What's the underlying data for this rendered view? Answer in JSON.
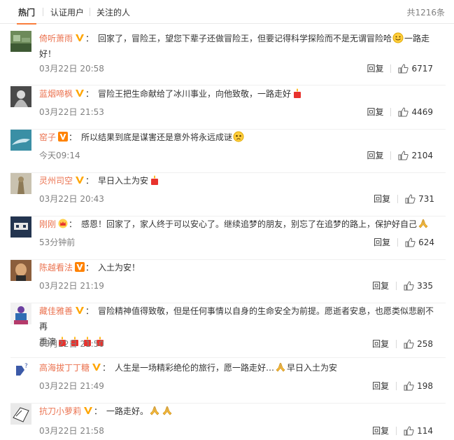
{
  "header": {
    "tabs": [
      {
        "label": "热门"
      },
      {
        "label": "认证用户"
      },
      {
        "label": "关注的人"
      }
    ],
    "total": "共1216条"
  },
  "labels": {
    "reply": "回复",
    "colon": "："
  },
  "colors": {
    "accent": "#fa7d3c",
    "username": "#eb7350",
    "vip": "#ffa500"
  },
  "comments": [
    {
      "user": "倚听萧雨",
      "badge": "v-yellow",
      "text1": "回家了，冒险王，望您下辈子还做冒险王，但要记得科学探险而不是无谓冒险哈",
      "emoji1": "smile-emoji",
      "text2": "一路走好！",
      "time": "03月22日 20:58",
      "likes": "6717"
    },
    {
      "user": "蓝烟啼枫",
      "badge": "v-yellow",
      "text1": "冒险王把生命献给了冰川事业，向他致敬，一路走好",
      "emoji1": "candle-emoji",
      "time": "03月22日 21:53",
      "likes": "4469"
    },
    {
      "user": "窑子",
      "badge": "v-orange",
      "text1": "所以结果到底是谋害还是意外将永远成谜",
      "emoji1": "sad-emoji",
      "time": "今天09:14",
      "likes": "2104"
    },
    {
      "user": "灵州司空",
      "badge": "v-yellow",
      "text1": "早日入土为安",
      "emoji1": "candle-emoji",
      "time": "03月22日 20:43",
      "likes": "731"
    },
    {
      "user": "刚刚",
      "badge": "crown",
      "text1": "感恩！回家了，家人终于可以安心了。继续追梦的朋友，别忘了在追梦的路上，保护好自己",
      "emoji1": "pray-emoji",
      "time": "53分钟前",
      "likes": "624"
    },
    {
      "user": "陈越看法",
      "badge": "v-orange",
      "text1": "入土为安！",
      "time": "03月22日 21:19",
      "likes": "335"
    },
    {
      "user": "藏佳雅善",
      "badge": "v-yellow",
      "text1": "冒险精神值得致敬，但是任何事情以自身的生命安全为前提。愿逝者安息，也愿类似悲剧不再",
      "text2": "重演",
      "time": "03月22日 21:50",
      "likes": "258"
    },
    {
      "user": "高海拔丁丁糖",
      "badge": "v-yellow",
      "text1": "人生是一场精彩绝伦的旅行，愿一路走好…",
      "text3": "早日入土为安",
      "time": "03月22日 21:49",
      "likes": "198"
    },
    {
      "user": "抗刀小萝莉",
      "badge": "v-yellow",
      "text1": "一路走好。",
      "time": "03月22日 21:58",
      "likes": "114"
    }
  ]
}
